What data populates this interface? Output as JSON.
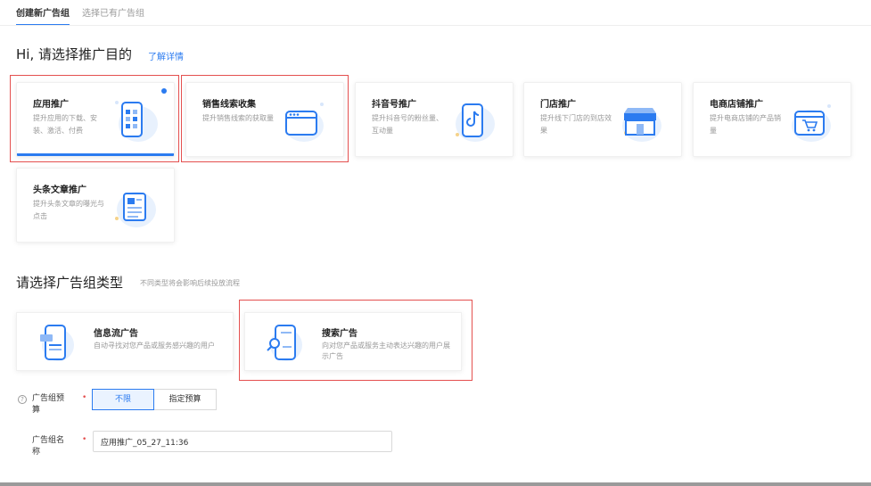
{
  "tabs": [
    {
      "label": "创建新广告组",
      "active": true
    },
    {
      "label": "选择已有广告组",
      "active": false
    }
  ],
  "purpose": {
    "heading": "Hi, 请选择推广目的",
    "link": "了解详情",
    "cards": [
      {
        "title": "应用推广",
        "desc": "提升应用的下载、安装、激活、付费",
        "icon": "phone-app-icon",
        "selected": true
      },
      {
        "title": "销售线索收集",
        "desc": "提升销售线索的获取量",
        "icon": "browser-window-icon",
        "selected": false
      },
      {
        "title": "抖音号推广",
        "desc": "提升抖音号的粉丝量、互动量",
        "icon": "tiktok-phone-icon",
        "selected": false
      },
      {
        "title": "门店推广",
        "desc": "提升线下门店的到店效果",
        "icon": "storefront-icon",
        "selected": false
      },
      {
        "title": "电商店铺推广",
        "desc": "提升电商店铺的产品销量",
        "icon": "shopping-cart-icon",
        "selected": false
      },
      {
        "title": "头条文章推广",
        "desc": "提升头条文章的曝光与点击",
        "icon": "article-icon",
        "selected": false
      }
    ]
  },
  "adtype": {
    "heading": "请选择广告组类型",
    "note": "不同类型将会影响后续投放流程",
    "cards": [
      {
        "title": "信息流广告",
        "desc": "自动寻找对您产品或服务感兴趣的用户",
        "icon": "feed-phone-icon"
      },
      {
        "title": "搜索广告",
        "desc": "向对您产品或服务主动表达兴趣的用户展示广告",
        "icon": "search-phone-icon"
      }
    ]
  },
  "form": {
    "help_glyph": "?",
    "required_mark": "•",
    "budget": {
      "label": "广告组预算",
      "options": [
        "不限",
        "指定预算"
      ],
      "selected": "不限"
    },
    "name": {
      "label": "广告组名称",
      "value": "应用推广_05_27_11:36"
    }
  },
  "colors": {
    "accent": "#2b7bf0",
    "highlight": "#e4504f"
  }
}
